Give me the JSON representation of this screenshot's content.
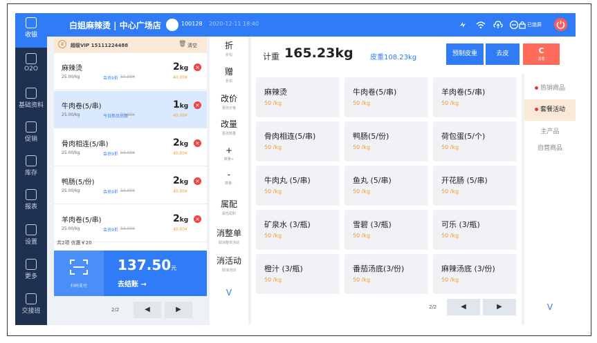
{
  "sidebar": {
    "items": [
      {
        "label": "收银",
        "icon": "download-icon"
      },
      {
        "label": "O2O",
        "icon": "bag-icon"
      },
      {
        "label": "基础资料",
        "icon": "folder-icon"
      },
      {
        "label": "促销",
        "icon": "promo-icon"
      },
      {
        "label": "库存",
        "icon": "box-icon"
      },
      {
        "label": "报表",
        "icon": "chart-icon"
      },
      {
        "label": "设置",
        "icon": "gear-icon"
      },
      {
        "label": "更多",
        "icon": "grid-icon"
      },
      {
        "label": "交接班",
        "icon": "handover-icon"
      }
    ]
  },
  "topbar": {
    "store": "白姐麻辣烫 | 中心广场店",
    "user_id": "100128",
    "datetime": "2020-12-11 18:40",
    "locked": "已锁屏"
  },
  "order": {
    "vip": "超级VIP 15111224488",
    "clear": "清空",
    "items": [
      {
        "name": "麻辣烫",
        "price": "25.00/kg",
        "discount": "会员9折",
        "orig": "50.00¥",
        "qty": "2",
        "unit": "kg",
        "subtotal": "40.00¥"
      },
      {
        "name": "牛肉卷(5/串)",
        "price": "25.00/kg",
        "discount": "今日新品优惠",
        "orig": "50.00¥",
        "qty": "1",
        "unit": "kg",
        "subtotal": "40.00¥"
      },
      {
        "name": "骨肉相连(5/串)",
        "price": "25.00/kg",
        "discount": "会员9折",
        "orig": "50.00¥",
        "qty": "2",
        "unit": "kg",
        "subtotal": "40.00¥"
      },
      {
        "name": "鸭肠(5/份)",
        "price": "25.00/kg",
        "discount": "会员9折",
        "orig": "50.00¥",
        "qty": "2",
        "unit": "kg",
        "subtotal": "40.00¥"
      },
      {
        "name": "羊肉卷(5/串)",
        "price": "25.00/kg",
        "discount": "会员9折",
        "orig": "50.00¥",
        "qty": "2",
        "unit": "kg",
        "subtotal": "40.00¥"
      }
    ],
    "summary": "共2项 优惠￥20"
  },
  "pay": {
    "scan": "扫码支付",
    "total": "137.50",
    "currency": "元",
    "checkout": "去结账 →"
  },
  "left_pager": {
    "page": "2/2",
    "prev": "◀",
    "next": "▶"
  },
  "actions": [
    {
      "title": "折",
      "sub": "折扣"
    },
    {
      "title": "赠",
      "sub": "折扣"
    },
    {
      "title": "改价",
      "sub": "更改价格"
    },
    {
      "title": "改量",
      "sub": "更改数量"
    },
    {
      "title": "+",
      "sub": "数量+"
    },
    {
      "title": "-",
      "sub": "数量-"
    },
    {
      "title": "属配",
      "sub": "属性配料"
    },
    {
      "title": "消整单",
      "sub": "取消整单活动"
    },
    {
      "title": "消活动",
      "sub": "取消活动"
    },
    {
      "title": "V",
      "sub": ""
    }
  ],
  "scale": {
    "label": "计重",
    "weight": "165.23kg",
    "tare": "皮重108.23kg",
    "preset_tare": "预制皮重",
    "remove_tare": "去皮",
    "clear": "C",
    "clear_sub": "清零"
  },
  "products": [
    {
      "name": "麻辣烫",
      "price": "50 /kg"
    },
    {
      "name": "牛肉卷(5/串)",
      "price": "50 /kg"
    },
    {
      "name": "羊肉卷(5/串)",
      "price": "50 /kg"
    },
    {
      "name": "骨肉相连(5/串)",
      "price": "50 /kg"
    },
    {
      "name": "鸭肠(5/份)",
      "price": "50 /kg"
    },
    {
      "name": "荷包蛋(5/个)",
      "price": "50 /kg"
    },
    {
      "name": "牛肉丸 (5/串)",
      "price": "50 /kg"
    },
    {
      "name": "鱼丸 (5/串)",
      "price": "50 /kg"
    },
    {
      "name": "开花肠 (5/串)",
      "price": "50 /kg"
    },
    {
      "name": "矿泉水 (3/瓶)",
      "price": "50 /kg"
    },
    {
      "name": "雪碧 (3/瓶)",
      "price": "50 /kg"
    },
    {
      "name": "可乐 (3/瓶)",
      "price": "50 /kg"
    },
    {
      "name": "橙汁 (3/瓶)",
      "price": "50 /kg"
    },
    {
      "name": "番茄汤底(3/份)",
      "price": "50 /kg"
    },
    {
      "name": "麻辣汤底 (3/份)",
      "price": "50 /kg"
    }
  ],
  "product_pager": {
    "page": "2/2",
    "prev": "◀",
    "next": "▶"
  },
  "categories": [
    {
      "label": "热销商品"
    },
    {
      "label": "套餐活动"
    },
    {
      "label": "主产品"
    },
    {
      "label": "自营商品"
    }
  ],
  "categories_more": "V",
  "colors": {
    "primary": "#2f7cf6",
    "sidebar": "#1f3151",
    "danger": "#f04343",
    "accent": "#f0a030"
  }
}
